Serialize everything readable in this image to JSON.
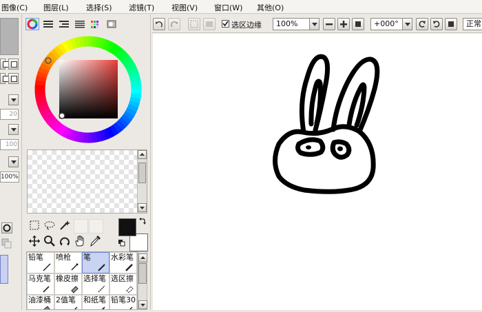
{
  "menubar": {
    "items": [
      {
        "label": "图像(C)"
      },
      {
        "label": "图层(L)"
      },
      {
        "label": "选择(S)"
      },
      {
        "label": "滤镜(T)"
      },
      {
        "label": "视图(V)"
      },
      {
        "label": "窗口(W)"
      },
      {
        "label": "其他(O)"
      }
    ]
  },
  "toolbar": {
    "selection_edge_label": "选区边缘",
    "selection_edge_checked": true,
    "zoom_value": "100%",
    "rotation_value": "+000°",
    "blend_mode_value": "正常"
  },
  "left_strip": {
    "value_20": "20",
    "value_100": "100",
    "value_100pct": "100%"
  },
  "brushes": [
    {
      "label": "铅笔",
      "icon": "pencil-icon"
    },
    {
      "label": "喷枪",
      "icon": "airbrush-icon"
    },
    {
      "label": "笔",
      "icon": "pen-icon"
    },
    {
      "label": "水彩笔",
      "icon": "watercolor-icon"
    },
    {
      "label": "马克笔",
      "icon": "marker-icon"
    },
    {
      "label": "橡皮擦",
      "icon": "eraser-icon"
    },
    {
      "label": "选择笔",
      "icon": "select-pen-icon"
    },
    {
      "label": "选区擦",
      "icon": "select-eraser-icon"
    },
    {
      "label": "油漆桶",
      "icon": "bucket-icon"
    },
    {
      "label": "2值笔",
      "icon": "binary-pen-icon"
    },
    {
      "label": "和纸笔",
      "icon": "washi-pen-icon"
    },
    {
      "label": "铅笔30",
      "icon": "pencil30-icon"
    }
  ],
  "colors": {
    "foreground": "#111111",
    "background": "#ffffff",
    "selected_brush_bg": "#c9d3f3",
    "canvas": "#ffffff",
    "hue_square": "#e8403a"
  }
}
